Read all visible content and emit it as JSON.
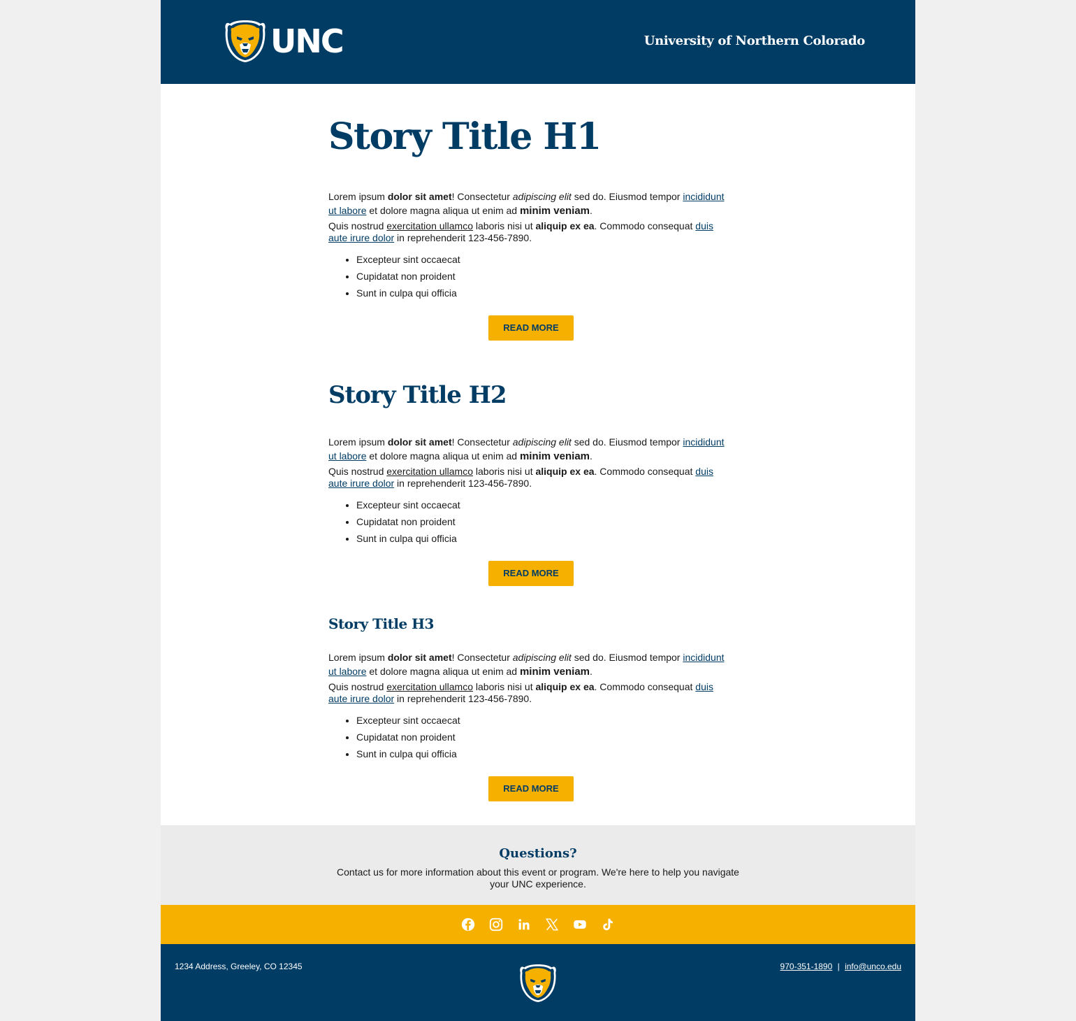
{
  "header": {
    "logo_text": "UNC",
    "university_name": "University of Northern Colorado"
  },
  "stories": [
    {
      "title": "Story Title H1",
      "p1": {
        "t1": "Lorem ipsum ",
        "b1": "dolor sit amet",
        "t2": "! Consectetur ",
        "i1": "adipiscing elit",
        "t3": " sed do. Eiusmod tempor ",
        "link1": "incididunt ut labore",
        "t4": " et dolore magna aliqua ut enim ad ",
        "big": "minim veniam",
        "t5": "."
      },
      "p2": {
        "t1": "Quis nostrud ",
        "u1": "exercitation ullamco",
        "t2": " laboris nisi ut ",
        "b1": "aliquip ex ea",
        "t3": ". Commodo consequat ",
        "link1": "duis aute irure dolor",
        "t4": " in reprehenderit 123-456-7890."
      },
      "bullets": [
        "Excepteur sint occaecat",
        "Cupidatat non proident",
        "Sunt in culpa qui officia"
      ],
      "button": "READ MORE"
    },
    {
      "title": "Story Title H2",
      "p1": {
        "t1": "Lorem ipsum ",
        "b1": "dolor sit amet",
        "t2": "! Consectetur ",
        "i1": "adipiscing elit",
        "t3": " sed do. Eiusmod tempor ",
        "link1": "incididunt ut labore",
        "t4": " et dolore magna aliqua ut enim ad ",
        "big": "minim veniam",
        "t5": "."
      },
      "p2": {
        "t1": "Quis nostrud ",
        "u1": "exercitation ullamco",
        "t2": " laboris nisi ut ",
        "b1": "aliquip ex ea",
        "t3": ". Commodo consequat ",
        "link1": "duis aute irure dolor",
        "t4": " in reprehenderit 123-456-7890."
      },
      "bullets": [
        "Excepteur sint occaecat",
        "Cupidatat non proident",
        "Sunt in culpa qui officia"
      ],
      "button": "READ MORE"
    },
    {
      "title": "Story Title H3",
      "p1": {
        "t1": "Lorem ipsum ",
        "b1": "dolor sit amet",
        "t2": "! Consectetur ",
        "i1": "adipiscing elit",
        "t3": " sed do. Eiusmod tempor ",
        "link1": "incididunt ut labore",
        "t4": " et dolore magna aliqua ut enim ad ",
        "big": "minim veniam",
        "t5": "."
      },
      "p2": {
        "t1": "Quis nostrud ",
        "u1": "exercitation ullamco",
        "t2": " laboris nisi ut ",
        "b1": "aliquip ex ea",
        "t3": ". Commodo consequat ",
        "link1": "duis aute irure dolor",
        "t4": " in reprehenderit 123-456-7890."
      },
      "bullets": [
        "Excepteur sint occaecat",
        "Cupidatat non proident",
        "Sunt in culpa qui officia"
      ],
      "button": "READ MORE"
    }
  ],
  "questions": {
    "title": "Questions?",
    "text": "Contact us for more information about this event or program. We're here to help you navigate your UNC experience."
  },
  "social_icons": [
    "facebook-icon",
    "instagram-icon",
    "linkedin-icon",
    "x-icon",
    "youtube-icon",
    "tiktok-icon"
  ],
  "footer": {
    "address": "1234 Address, Greeley, CO 12345",
    "phone": "970-351-1890",
    "separator": "|",
    "email": "info@unco.edu"
  },
  "colors": {
    "navy": "#013c65",
    "gold": "#f6b000",
    "light_gray": "#ebebeb",
    "page_bg": "#f0f0f0"
  }
}
